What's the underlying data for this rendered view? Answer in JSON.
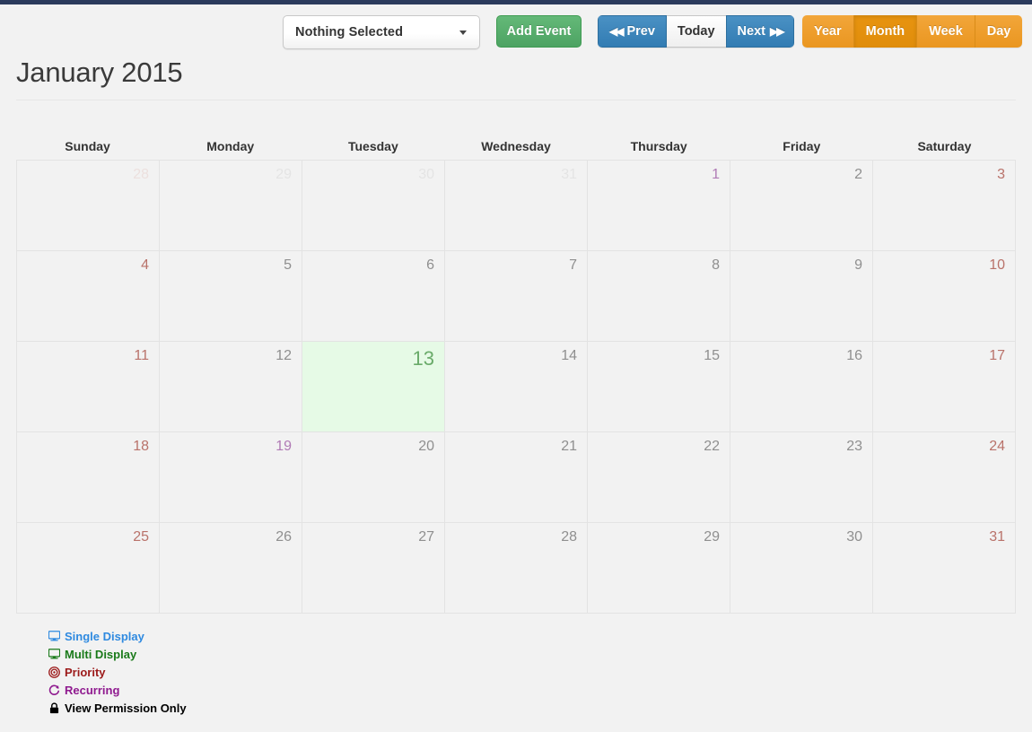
{
  "toolbar": {
    "select": {
      "value": "Nothing Selected",
      "icon": "chevron-down-icon"
    },
    "add_event": "Add Event",
    "nav": {
      "prev": "Prev",
      "today": "Today",
      "next": "Next",
      "prev_arrows": "◀◀",
      "next_arrows": "▶▶"
    },
    "views": [
      {
        "label": "Year",
        "active": false
      },
      {
        "label": "Month",
        "active": true
      },
      {
        "label": "Week",
        "active": false
      },
      {
        "label": "Day",
        "active": false
      }
    ]
  },
  "title": "January 2015",
  "calendar": {
    "weekdays": [
      "Sunday",
      "Monday",
      "Tuesday",
      "Wednesday",
      "Thursday",
      "Friday",
      "Saturday"
    ],
    "weeks": [
      [
        {
          "day": "28",
          "style": "muted-sat"
        },
        {
          "day": "29",
          "style": "muted"
        },
        {
          "day": "30",
          "style": "muted"
        },
        {
          "day": "31",
          "style": "muted"
        },
        {
          "day": "1",
          "style": "holiday"
        },
        {
          "day": "2",
          "style": "normal"
        },
        {
          "day": "3",
          "style": "saturday"
        }
      ],
      [
        {
          "day": "4",
          "style": "saturday"
        },
        {
          "day": "5",
          "style": "normal"
        },
        {
          "day": "6",
          "style": "normal"
        },
        {
          "day": "7",
          "style": "normal"
        },
        {
          "day": "8",
          "style": "normal"
        },
        {
          "day": "9",
          "style": "normal"
        },
        {
          "day": "10",
          "style": "saturday"
        }
      ],
      [
        {
          "day": "11",
          "style": "saturday"
        },
        {
          "day": "12",
          "style": "normal"
        },
        {
          "day": "13",
          "style": "today"
        },
        {
          "day": "14",
          "style": "normal"
        },
        {
          "day": "15",
          "style": "normal"
        },
        {
          "day": "16",
          "style": "normal"
        },
        {
          "day": "17",
          "style": "saturday"
        }
      ],
      [
        {
          "day": "18",
          "style": "saturday"
        },
        {
          "day": "19",
          "style": "holiday"
        },
        {
          "day": "20",
          "style": "normal"
        },
        {
          "day": "21",
          "style": "normal"
        },
        {
          "day": "22",
          "style": "normal"
        },
        {
          "day": "23",
          "style": "normal"
        },
        {
          "day": "24",
          "style": "saturday"
        }
      ],
      [
        {
          "day": "25",
          "style": "saturday"
        },
        {
          "day": "26",
          "style": "normal"
        },
        {
          "day": "27",
          "style": "normal"
        },
        {
          "day": "28",
          "style": "normal"
        },
        {
          "day": "29",
          "style": "normal"
        },
        {
          "day": "30",
          "style": "normal"
        },
        {
          "day": "31",
          "style": "saturday"
        }
      ]
    ]
  },
  "legend": [
    {
      "label": "Single Display",
      "icon": "monitor-icon",
      "class": "lg-single"
    },
    {
      "label": "Multi Display",
      "icon": "monitor-icon",
      "class": "lg-multi"
    },
    {
      "label": "Priority",
      "icon": "bullseye-icon",
      "class": "lg-prio"
    },
    {
      "label": "Recurring",
      "icon": "refresh-icon",
      "class": "lg-recur"
    },
    {
      "label": "View Permission Only",
      "icon": "lock-icon",
      "class": "lg-lock"
    }
  ],
  "colors": {
    "topbar": "#2b3a5c",
    "background": "#f2f2f2",
    "accent_green": "#4da363",
    "accent_blue": "#327cb3",
    "accent_orange": "#ea9620",
    "today_bg": "#e6fae6"
  }
}
